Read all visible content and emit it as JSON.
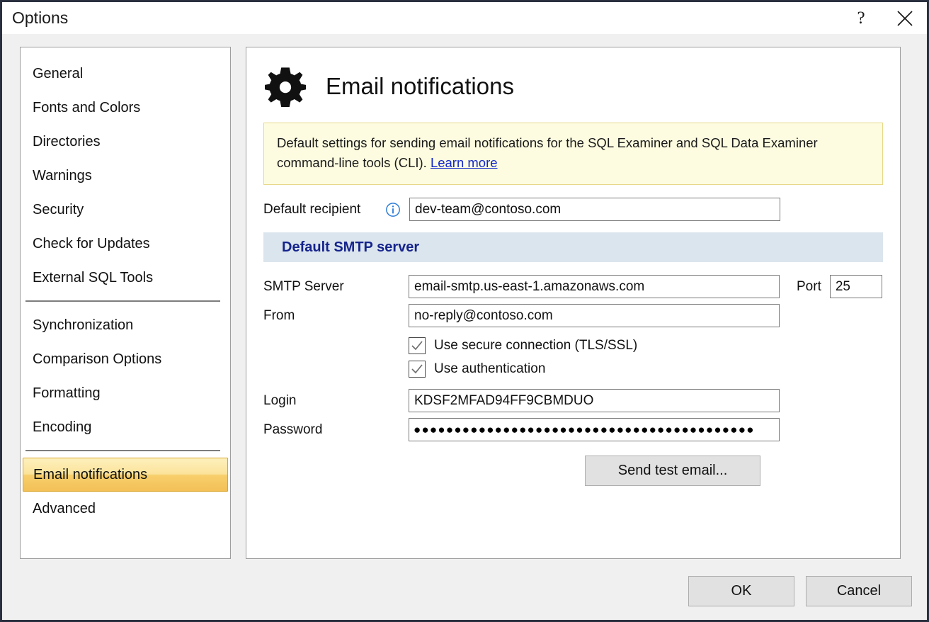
{
  "window": {
    "title": "Options",
    "help_icon": "question-mark-icon",
    "close_icon": "close-icon"
  },
  "sidebar": {
    "groups": [
      {
        "items": [
          {
            "label": "General",
            "selected": false
          },
          {
            "label": "Fonts and Colors",
            "selected": false
          },
          {
            "label": "Directories",
            "selected": false
          },
          {
            "label": "Warnings",
            "selected": false
          },
          {
            "label": "Security",
            "selected": false
          },
          {
            "label": "Check for Updates",
            "selected": false
          },
          {
            "label": "External SQL Tools",
            "selected": false
          }
        ]
      },
      {
        "items": [
          {
            "label": "Synchronization",
            "selected": false
          },
          {
            "label": "Comparison Options",
            "selected": false
          },
          {
            "label": "Formatting",
            "selected": false
          },
          {
            "label": "Encoding",
            "selected": false
          }
        ]
      },
      {
        "items": [
          {
            "label": "Email notifications",
            "selected": true
          },
          {
            "label": "Advanced",
            "selected": false
          }
        ]
      }
    ]
  },
  "panel": {
    "icon": "gear-icon",
    "title": "Email notifications",
    "banner": {
      "text": "Default settings for sending email notifications for the SQL Examiner and SQL Data Examiner command-line tools (CLI). ",
      "link_label": "Learn more"
    },
    "default_recipient": {
      "label": "Default recipient",
      "info_icon": "info-circle-icon",
      "value": "dev-team@contoso.com",
      "placeholder": ""
    },
    "smtp_section": {
      "header": "Default SMTP server",
      "server": {
        "label": "SMTP Server",
        "value": "email-smtp.us-east-1.amazonaws.com",
        "placeholder": ""
      },
      "port": {
        "label": "Port",
        "value": "25",
        "placeholder": ""
      },
      "from": {
        "label": "From",
        "value": "no-reply@contoso.com",
        "placeholder": ""
      },
      "use_secure_connection": {
        "label": "Use secure connection (TLS/SSL)",
        "checked": true
      },
      "use_authentication": {
        "label": "Use authentication",
        "checked": true
      },
      "login": {
        "label": "Login",
        "value": "KDSF2MFAD94FF9CBMDUO",
        "placeholder": ""
      },
      "password": {
        "label": "Password",
        "masked_value": "●●●●●●●●●●●●●●●●●●●●●●●●●●●●●●●●●●●●●●●●●●",
        "placeholder": ""
      },
      "send_test_label": "Send test email..."
    }
  },
  "footer": {
    "ok_label": "OK",
    "cancel_label": "Cancel"
  },
  "colors": {
    "window_border": "#2b3040",
    "body_background": "#f0f0f0",
    "selection_gradient_top": "#fdf0bd",
    "selection_gradient_bottom": "#f3c057",
    "selection_border": "#d9a62b",
    "banner_background": "#fdfce0",
    "banner_border": "#e8d98a",
    "link": "#1126cc",
    "section_header_background": "#dbe5ed",
    "section_header_text": "#15248c",
    "button_face": "#e1e1e1",
    "info_icon": "#2b7bd6"
  }
}
